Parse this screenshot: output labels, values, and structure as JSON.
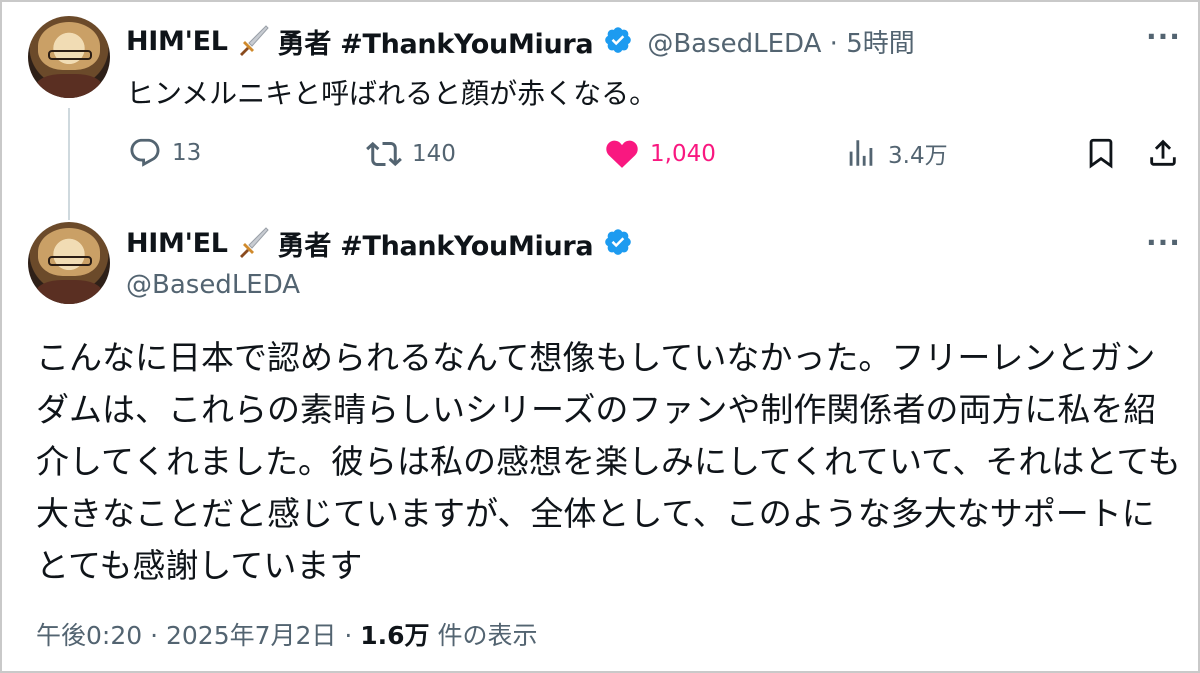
{
  "tweet1": {
    "name": "HIM'EL",
    "title": "勇者 #ThankYouMiura",
    "handle": "@BasedLEDA",
    "time": "5時間",
    "text": "ヒンメルニキと呼ばれると顔が赤くなる。",
    "stats": {
      "replies": "13",
      "retweets": "140",
      "likes": "1,040",
      "views": "3.4万"
    }
  },
  "tweet2": {
    "name": "HIM'EL",
    "title": "勇者 #ThankYouMiura",
    "handle": "@BasedLEDA",
    "text": "こんなに日本で認められるなんて想像もしていなかった。フリーレンとガンダムは、これらの素晴らしいシリーズのファンや制作関係者の両方に私を紹介してくれました。彼らは私の感想を楽しみにしてくれていて、それはとても大きなことだと感じていますが、全体として、このような多大なサポートにとても感謝しています",
    "timestamp": "午後0:20 · 2025年7月2日 · ",
    "views_count": "1.6万",
    "views_label": " 件の表示"
  },
  "icons": [
    "avatar",
    "dagger-emoji-icon",
    "verified-badge-icon",
    "more-icon",
    "reply-icon",
    "retweet-icon",
    "like-icon",
    "views-icon",
    "bookmark-icon",
    "share-icon"
  ],
  "colors": {
    "like": "#f91880",
    "verified": "#1d9bf0",
    "secondary": "#536471"
  }
}
